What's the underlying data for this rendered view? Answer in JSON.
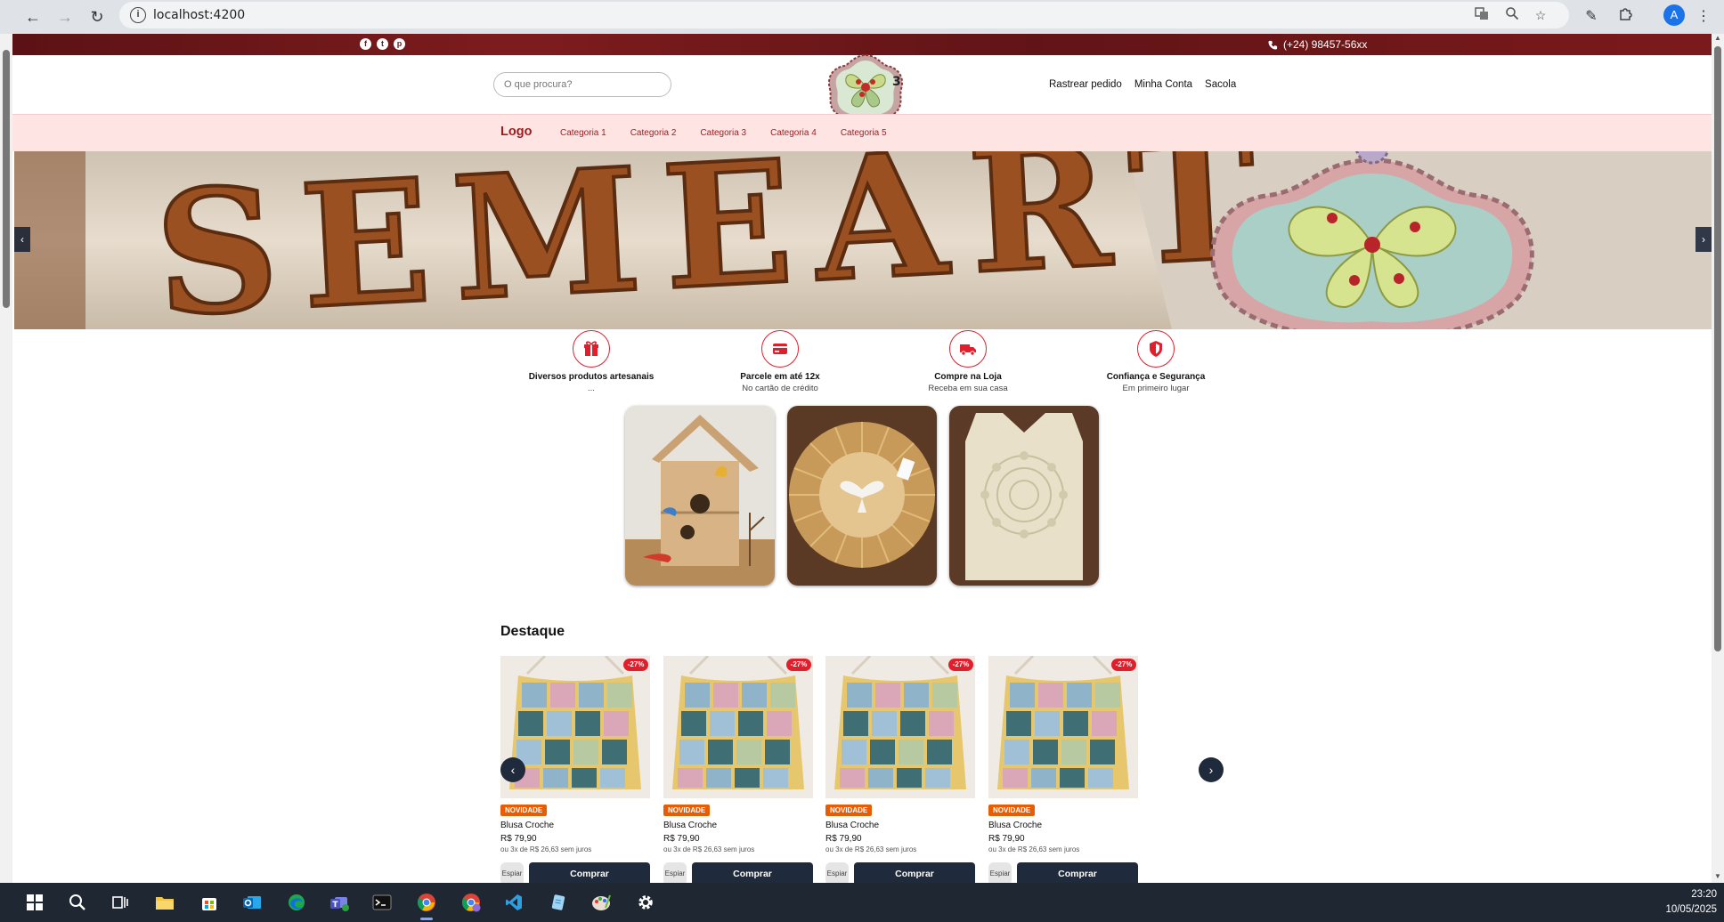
{
  "browser": {
    "url": "localhost:4200",
    "profile_initial": "A"
  },
  "topbar": {
    "phone": "(+24) 98457-56xx"
  },
  "header": {
    "search_placeholder": "O que procura?",
    "nav": [
      "Rastrear pedido",
      "Minha Conta",
      "Sacola"
    ]
  },
  "catbar": {
    "logo": "Logo",
    "categories": [
      "Categoria 1",
      "Categoria 2",
      "Categoria 3",
      "Categoria 4",
      "Categoria 5"
    ]
  },
  "hero": {
    "sign_text": "SEMEART",
    "prev": "‹",
    "next": "›"
  },
  "features": [
    {
      "icon": "gift-icon",
      "title": "Diversos produtos artesanais",
      "subtitle": "..."
    },
    {
      "icon": "credit-card-icon",
      "title": "Parcele em até 12x",
      "subtitle": "No cartão de crédito"
    },
    {
      "icon": "truck-icon",
      "title": "Compre na Loja",
      "subtitle": "Receba em sua casa"
    },
    {
      "icon": "shield-icon",
      "title": "Confiança e Segurança",
      "subtitle": "Em primeiro lugar"
    }
  ],
  "section": {
    "title": "Destaque"
  },
  "products": [
    {
      "discount": "-27%",
      "badge": "NOVIDADE",
      "name": "Blusa Croche",
      "price": "R$ 79,90",
      "installments": "ou 3x de R$ 26,63 sem juros",
      "spy": "Espiar",
      "buy": "Comprar"
    },
    {
      "discount": "-27%",
      "badge": "NOVIDADE",
      "name": "Blusa Croche",
      "price": "R$ 79,90",
      "installments": "ou 3x de R$ 26,63 sem juros",
      "spy": "Espiar",
      "buy": "Comprar"
    },
    {
      "discount": "-27%",
      "badge": "NOVIDADE",
      "name": "Blusa Croche",
      "price": "R$ 79,90",
      "installments": "ou 3x de R$ 26,63 sem juros",
      "spy": "Espiar",
      "buy": "Comprar"
    },
    {
      "discount": "-27%",
      "badge": "NOVIDADE",
      "name": "Blusa Croche",
      "price": "R$ 79,90",
      "installments": "ou 3x de R$ 26,63 sem juros",
      "spy": "Espiar",
      "buy": "Comprar"
    }
  ],
  "taskbar": {
    "time": "23:20",
    "date": "10/05/2025"
  }
}
